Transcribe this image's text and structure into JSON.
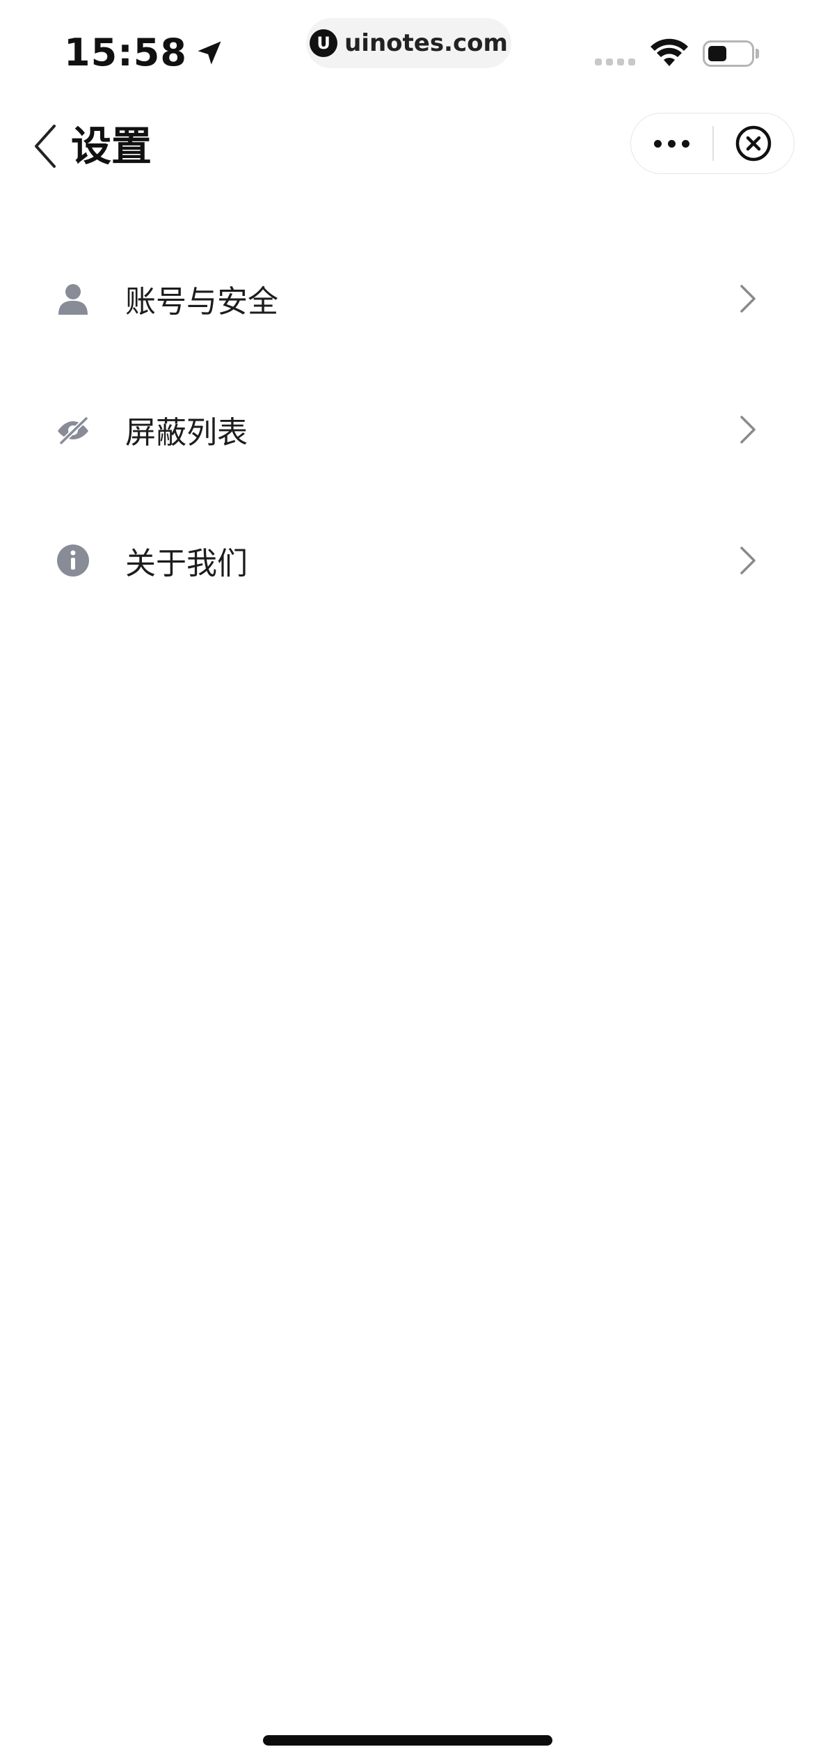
{
  "status_bar": {
    "time": "15:58",
    "url": "uinotes.com",
    "url_logo_letter": "U",
    "location_icon": "location-arrow-icon",
    "wifi_icon": "wifi-icon",
    "battery_icon": "battery-icon",
    "battery_level": 0.45
  },
  "nav": {
    "title": "设置",
    "back_icon": "chevron-left-icon",
    "more_icon": "more-dots-icon",
    "close_icon": "close-circle-icon"
  },
  "menu": {
    "items": [
      {
        "label": "账号与安全",
        "icon": "user-icon"
      },
      {
        "label": "屏蔽列表",
        "icon": "eye-off-icon"
      },
      {
        "label": "关于我们",
        "icon": "info-icon"
      }
    ],
    "icon_color": "#878c97",
    "chevron_color": "#8a8a8a"
  }
}
